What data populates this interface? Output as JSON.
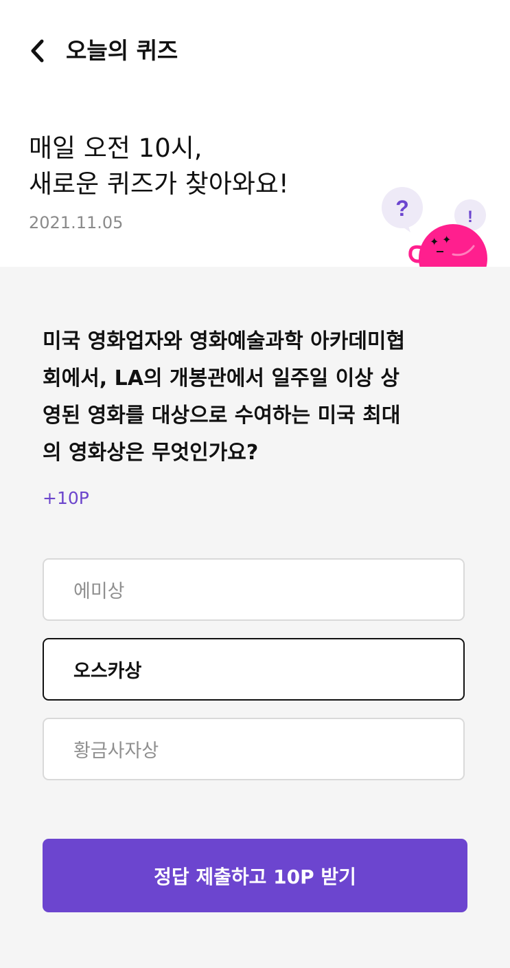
{
  "header": {
    "title": "오늘의 퀴즈",
    "back_icon": "chevron-left-icon"
  },
  "intro": {
    "headline_line1": "매일 오전 10시,",
    "headline_line2": "새로운 퀴즈가 찾아와요!",
    "date": "2021.11.05",
    "bubble_question": "?",
    "bubble_exclaim": "!"
  },
  "quiz": {
    "question_lines": [
      "미국 영화업자와 영화예술과학 아카데미협",
      "회에서, LA의 개봉관에서 일주일 이상 상",
      "영된 영화를 대상으로 수여하는 미국 최대",
      "의 영화상은 무엇인가요?"
    ],
    "points": "+10P",
    "options": [
      {
        "label": "에미상",
        "selected": false
      },
      {
        "label": "오스카상",
        "selected": true
      },
      {
        "label": "황금사자상",
        "selected": false
      }
    ],
    "submit_label": "정답 제출하고 10P 받기"
  },
  "colors": {
    "accent": "#6c45cf",
    "mascot": "#ff1f8e",
    "bubble": "#eeeaf7",
    "page_bg": "#f5f5f5"
  }
}
